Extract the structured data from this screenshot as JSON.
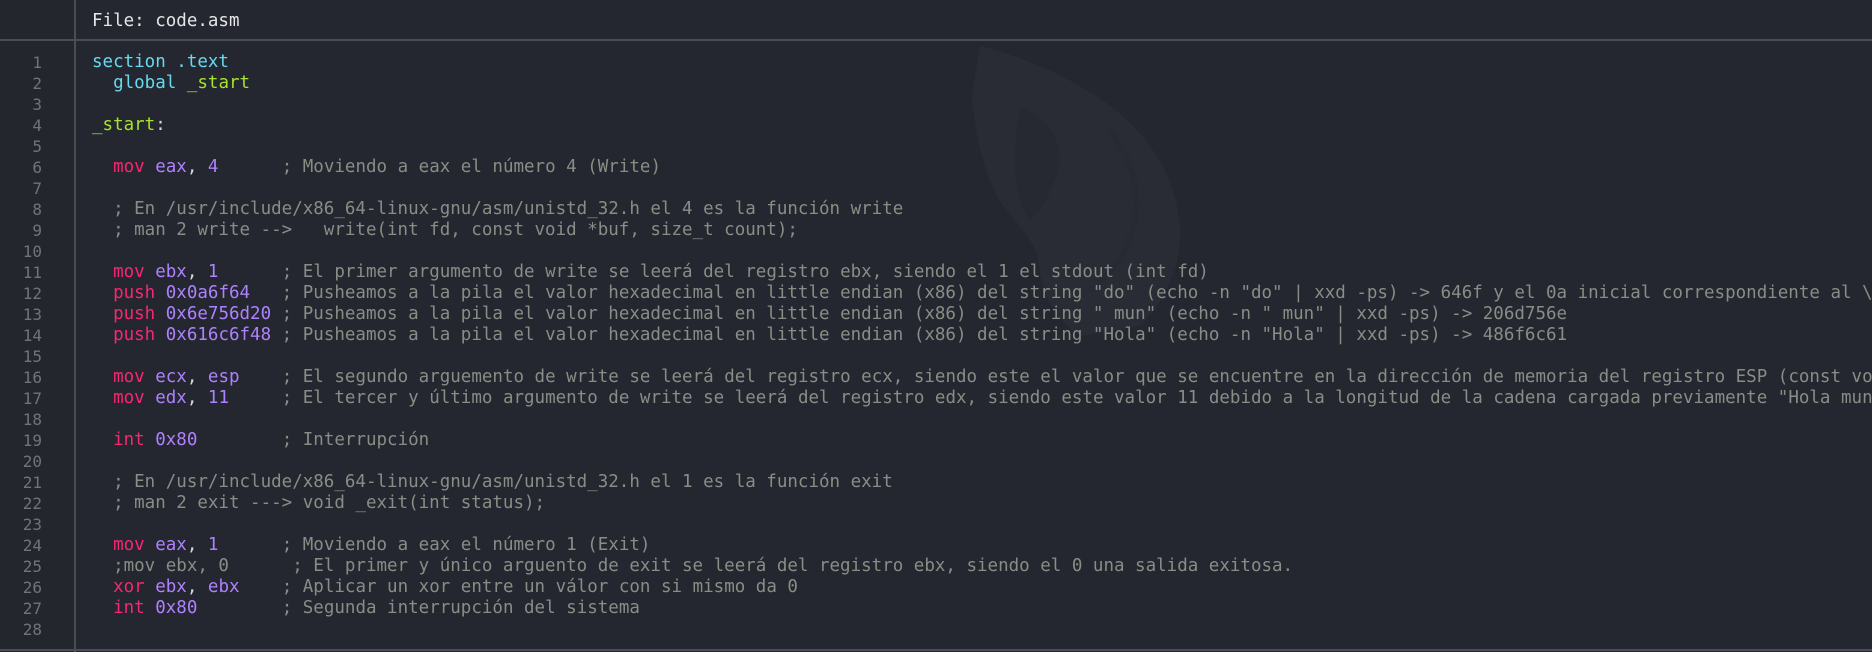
{
  "header": {
    "title": "File: code.asm"
  },
  "watermark": {
    "icon": "hooded-figure-watermark-icon"
  },
  "colors": {
    "background": "#24272f",
    "keyword": "#f92672",
    "directive": "#66d9ef",
    "label": "#a6e22e",
    "register_number": "#ae81ff",
    "comment": "#8a8d85",
    "line_number": "#6f737b"
  },
  "lines": [
    {
      "n": "1",
      "t": [
        [
          "dir",
          "section .text"
        ]
      ]
    },
    {
      "n": "2",
      "t": [
        [
          "pun",
          "  "
        ],
        [
          "dir",
          "global "
        ],
        [
          "lbl",
          "_start"
        ]
      ]
    },
    {
      "n": "3",
      "t": []
    },
    {
      "n": "4",
      "t": [
        [
          "lbl",
          "_start"
        ],
        [
          "pun",
          ":"
        ]
      ]
    },
    {
      "n": "5",
      "t": []
    },
    {
      "n": "6",
      "t": [
        [
          "pun",
          "  "
        ],
        [
          "kw",
          "mov "
        ],
        [
          "reg",
          "eax"
        ],
        [
          "pun",
          ", "
        ],
        [
          "num",
          "4"
        ],
        [
          "pun",
          "      "
        ],
        [
          "cm",
          "; Moviendo a eax el número 4 (Write)"
        ]
      ]
    },
    {
      "n": "7",
      "t": []
    },
    {
      "n": "8",
      "t": [
        [
          "pun",
          "  "
        ],
        [
          "cm",
          "; En /usr/include/x86_64-linux-gnu/asm/unistd_32.h el 4 es la función write"
        ]
      ]
    },
    {
      "n": "9",
      "t": [
        [
          "pun",
          "  "
        ],
        [
          "cm",
          "; man 2 write -->   write(int fd, const void *buf, size_t count);"
        ]
      ]
    },
    {
      "n": "10",
      "t": []
    },
    {
      "n": "11",
      "t": [
        [
          "pun",
          "  "
        ],
        [
          "kw",
          "mov "
        ],
        [
          "reg",
          "ebx"
        ],
        [
          "pun",
          ", "
        ],
        [
          "num",
          "1"
        ],
        [
          "pun",
          "      "
        ],
        [
          "cm",
          "; El primer argumento de write se leerá del registro ebx, siendo el 1 el stdout (int fd)"
        ]
      ]
    },
    {
      "n": "12",
      "t": [
        [
          "pun",
          "  "
        ],
        [
          "kw",
          "push "
        ],
        [
          "num",
          "0x0a6f64"
        ],
        [
          "pun",
          "   "
        ],
        [
          "cm",
          "; Pusheamos a la pila el valor hexadecimal en little endian (x86) del string \"do\" (echo -n \"do\" | xxd -ps) -> 646f y el 0a inicial correspondiente al \\n"
        ]
      ]
    },
    {
      "n": "13",
      "t": [
        [
          "pun",
          "  "
        ],
        [
          "kw",
          "push "
        ],
        [
          "num",
          "0x6e756d20"
        ],
        [
          "pun",
          " "
        ],
        [
          "cm",
          "; Pusheamos a la pila el valor hexadecimal en little endian (x86) del string \" mun\" (echo -n \" mun\" | xxd -ps) -> 206d756e"
        ]
      ]
    },
    {
      "n": "14",
      "t": [
        [
          "pun",
          "  "
        ],
        [
          "kw",
          "push "
        ],
        [
          "num",
          "0x616c6f48"
        ],
        [
          "pun",
          " "
        ],
        [
          "cm",
          "; Pusheamos a la pila el valor hexadecimal en little endian (x86) del string \"Hola\" (echo -n \"Hola\" | xxd -ps) -> 486f6c61"
        ]
      ]
    },
    {
      "n": "15",
      "t": []
    },
    {
      "n": "16",
      "t": [
        [
          "pun",
          "  "
        ],
        [
          "kw",
          "mov "
        ],
        [
          "reg",
          "ecx"
        ],
        [
          "pun",
          ", "
        ],
        [
          "reg",
          "esp"
        ],
        [
          "pun",
          "    "
        ],
        [
          "cm",
          "; El segundo arguemento de write se leerá del registro ecx, siendo este el valor que se encuentre en la dirección de memoria del registro ESP (const voud *buf)"
        ]
      ]
    },
    {
      "n": "17",
      "t": [
        [
          "pun",
          "  "
        ],
        [
          "kw",
          "mov "
        ],
        [
          "reg",
          "edx"
        ],
        [
          "pun",
          ", "
        ],
        [
          "num",
          "11"
        ],
        [
          "pun",
          "     "
        ],
        [
          "cm",
          "; El tercer y último argumento de write se leerá del registro edx, siendo este valor 11 debido a la longitud de la cadena cargada previamente \"Hola mundo\\n\""
        ]
      ]
    },
    {
      "n": "18",
      "t": []
    },
    {
      "n": "19",
      "t": [
        [
          "pun",
          "  "
        ],
        [
          "kw",
          "int "
        ],
        [
          "num",
          "0x80"
        ],
        [
          "pun",
          "        "
        ],
        [
          "cm",
          "; Interrupción"
        ]
      ]
    },
    {
      "n": "20",
      "t": []
    },
    {
      "n": "21",
      "t": [
        [
          "pun",
          "  "
        ],
        [
          "cm",
          "; En /usr/include/x86_64-linux-gnu/asm/unistd_32.h el 1 es la función exit"
        ]
      ]
    },
    {
      "n": "22",
      "t": [
        [
          "pun",
          "  "
        ],
        [
          "cm",
          "; man 2 exit ---> void _exit(int status);"
        ]
      ]
    },
    {
      "n": "23",
      "t": []
    },
    {
      "n": "24",
      "t": [
        [
          "pun",
          "  "
        ],
        [
          "kw",
          "mov "
        ],
        [
          "reg",
          "eax"
        ],
        [
          "pun",
          ", "
        ],
        [
          "num",
          "1"
        ],
        [
          "pun",
          "      "
        ],
        [
          "cm",
          "; Moviendo a eax el número 1 (Exit)"
        ]
      ]
    },
    {
      "n": "25",
      "t": [
        [
          "pun",
          "  "
        ],
        [
          "cm",
          ";mov ebx, 0      ; El primer y único arguento de exit se leerá del registro ebx, siendo el 0 una salida exitosa."
        ]
      ]
    },
    {
      "n": "26",
      "t": [
        [
          "pun",
          "  "
        ],
        [
          "kw",
          "xor "
        ],
        [
          "reg",
          "ebx"
        ],
        [
          "pun",
          ", "
        ],
        [
          "reg",
          "ebx"
        ],
        [
          "pun",
          "    "
        ],
        [
          "cm",
          "; Aplicar un xor entre un válor con si mismo da 0"
        ]
      ]
    },
    {
      "n": "27",
      "t": [
        [
          "pun",
          "  "
        ],
        [
          "kw",
          "int "
        ],
        [
          "num",
          "0x80"
        ],
        [
          "pun",
          "        "
        ],
        [
          "cm",
          "; Segunda interrupción del sistema"
        ]
      ]
    },
    {
      "n": "28",
      "t": []
    }
  ]
}
